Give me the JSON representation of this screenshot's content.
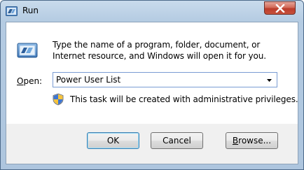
{
  "window": {
    "title": "Run",
    "close_icon": "close-icon"
  },
  "dialog": {
    "description": "Type the name of a program, folder, document, or Internet resource, and Windows will open it for you.",
    "open_label_accel": "O",
    "open_label_rest": "pen:",
    "open_value": "Power User List",
    "admin_note": "This task will be created with administrative privileges."
  },
  "buttons": {
    "ok": "OK",
    "cancel": "Cancel",
    "browse_accel": "B",
    "browse_rest": "rowse..."
  },
  "icons": {
    "title": "run-icon",
    "main": "run-icon",
    "uac": "uac-shield-icon",
    "dropdown": "chevron-down-icon"
  },
  "colors": {
    "title_bar": "#b9cfe6",
    "close_button": "#c7513b",
    "dialog_body": "#ffffff",
    "button_area": "#f0f0f0",
    "default_button_border": "#3c7fb1"
  }
}
